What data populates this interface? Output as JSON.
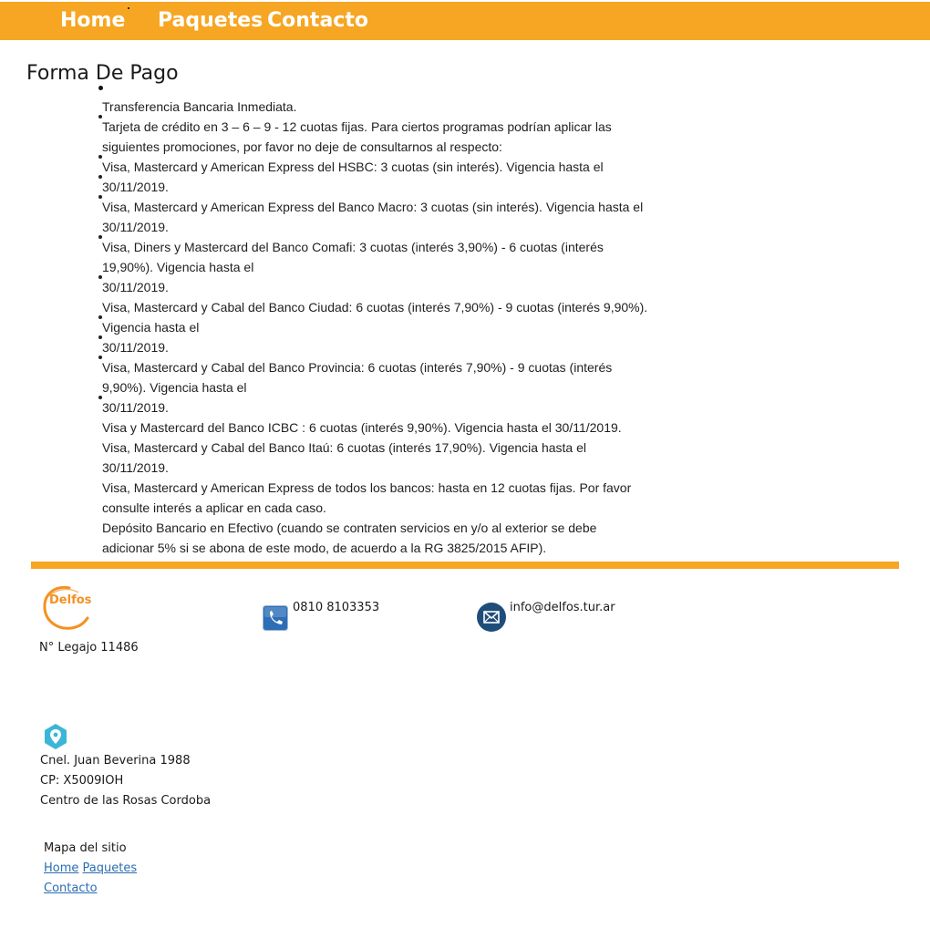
{
  "nav": {
    "home": "Home",
    "paquetes": "Paquetes",
    "contacto": "Contacto",
    "background_color": "#f6a623"
  },
  "page_title": "Forma De Pago",
  "payment_lines": [
    "Transferencia Bancaria Inmediata.",
    "Tarjeta de crédito en 3 – 6 – 9 - 12 cuotas fijas. Para ciertos programas podrían aplicar las",
    "siguientes promociones, por favor no deje de consultarnos al respecto:",
    "Visa, Mastercard y American Express del HSBC: 3 cuotas (sin interés). Vigencia hasta el",
    "30/11/2019.",
    "Visa, Mastercard y American Express del Banco Macro: 3 cuotas (sin interés). Vigencia hasta el",
    "30/11/2019.",
    "Visa, Diners y Mastercard del Banco Comafi: 3 cuotas (interés 3,90%) - 6 cuotas (interés",
    "19,90%). Vigencia hasta el",
    "30/11/2019.",
    "Visa, Mastercard y Cabal del Banco Ciudad: 6 cuotas (interés 7,90%) - 9 cuotas (interés 9,90%).",
    "Vigencia hasta el",
    "30/11/2019.",
    "Visa, Mastercard y Cabal del Banco Provincia: 6 cuotas (interés 7,90%) - 9 cuotas (interés",
    "9,90%). Vigencia hasta el",
    "30/11/2019.",
    "Visa y Mastercard del Banco ICBC : 6 cuotas (interés 9,90%). Vigencia hasta el 30/11/2019.",
    "Visa, Mastercard y Cabal del Banco Itaú: 6 cuotas (interés 17,90%). Vigencia hasta el",
    "30/11/2019.",
    "Visa, Mastercard y American Express de todos los bancos: hasta en 12 cuotas fijas. Por favor",
    "consulte interés a aplicar en cada caso.",
    "Depósito Bancario en Efectivo (cuando se contraten servicios en y/o al exterior se debe",
    "adicionar 5% si se abona de este modo, de acuerdo a la RG 3825/2015 AFIP)."
  ],
  "footer": {
    "logo_text": "Delfos",
    "legajo": "N° Legajo 11486",
    "phone": "0810 8103353",
    "email": "info@delfos.tur.ar",
    "address_line1": "Cnel. Juan Beverina 1988",
    "address_line2": "CP: X5009IOH",
    "address_line3": "Centro de las Rosas Cordoba",
    "sitemap_title": "Mapa del sitio",
    "sitemap_home": "Home",
    "sitemap_paquetes": "Paquetes",
    "sitemap_contacto": "Contacto",
    "accent_color": "#f6a623",
    "link_color": "#2a6db3"
  }
}
